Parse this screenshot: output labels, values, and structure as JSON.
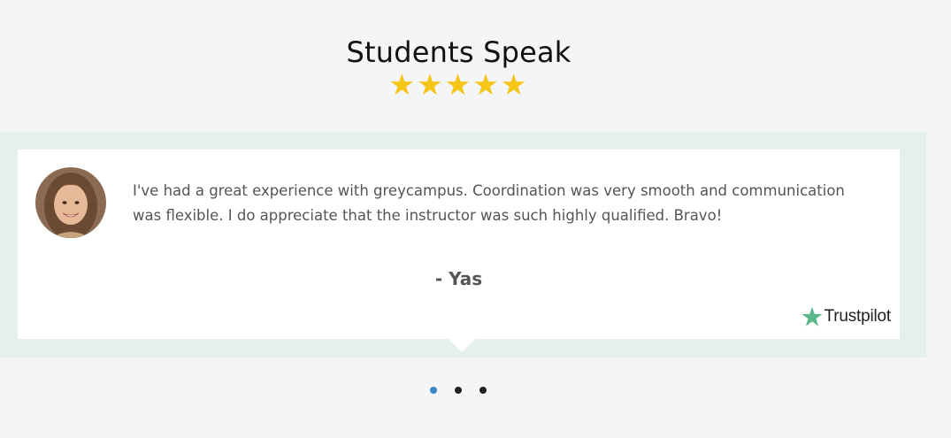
{
  "section": {
    "title": "Students Speak",
    "rating": "★★★★★",
    "star_color": "#f5c518"
  },
  "testimonial": {
    "quote": "I've had a great experience with greycampus. Coordination was very smooth and communication was flexible. I do appreciate that the instructor was such highly qualified. Bravo!",
    "author": "- Yas",
    "badge_text": "Trustpilot",
    "badge_icon": "trustpilot-star-icon",
    "badge_color": "#5cb88a"
  },
  "carousel": {
    "active_index": 0,
    "total": 3,
    "active_color": "#3a87c8"
  }
}
